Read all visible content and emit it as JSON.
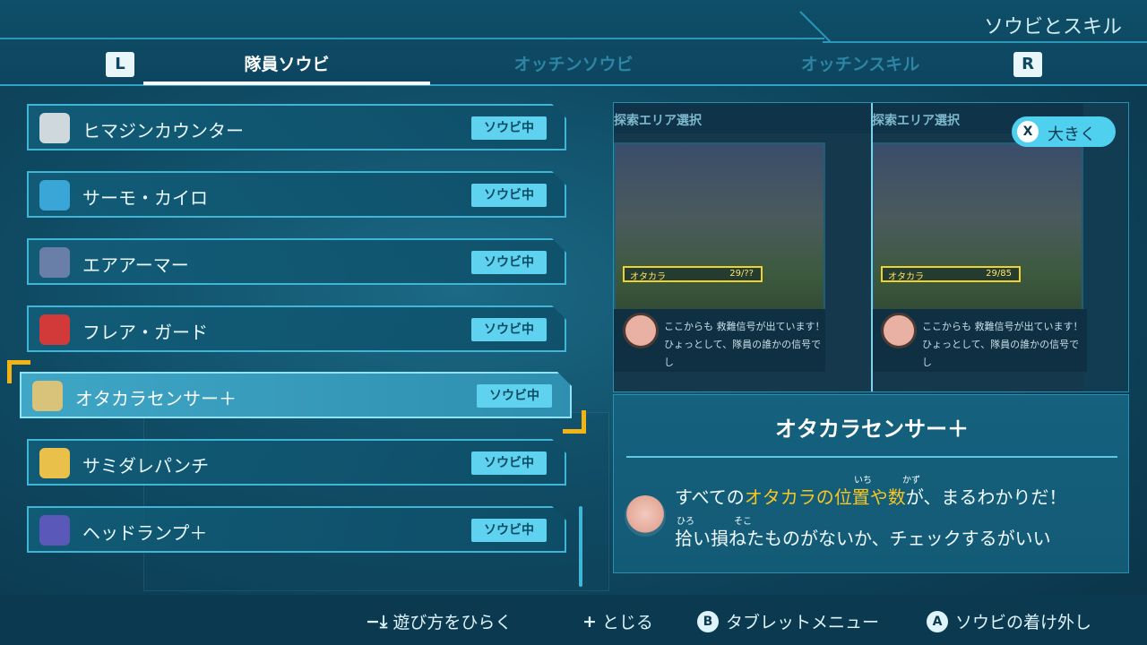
{
  "header": {
    "section_title": "ソウビとスキル",
    "left_bumper": "L",
    "right_bumper": "R",
    "tabs": [
      {
        "label": "隊員ソウビ",
        "active": true
      },
      {
        "label": "オッチンソウビ",
        "active": false
      },
      {
        "label": "オッチンスキル",
        "active": false
      }
    ]
  },
  "list": {
    "items": [
      {
        "name": "ヒマジンカウンター",
        "badge": "ソウビ中",
        "icon": "counter-device-icon"
      },
      {
        "name": "サーモ・カイロ",
        "badge": "ソウビ中",
        "icon": "thermo-warmer-icon"
      },
      {
        "name": "エアアーマー",
        "badge": "ソウビ中",
        "icon": "air-armor-icon"
      },
      {
        "name": "フレア・ガード",
        "badge": "ソウビ中",
        "icon": "flare-guard-icon"
      },
      {
        "name": "オタカラセンサー＋",
        "badge": "ソウビ中",
        "icon": "treasure-sensor-icon",
        "selected": true
      },
      {
        "name": "サミダレパンチ",
        "badge": "ソウビ中",
        "icon": "rapid-punch-icon"
      },
      {
        "name": "ヘッドランプ＋",
        "badge": "ソウビ中",
        "icon": "headlamp-icon"
      }
    ]
  },
  "preview": {
    "screen_title_left": "探索エリア選択",
    "screen_title_right": "探索エリア選択",
    "zoom_button_key": "X",
    "zoom_button_label": "大きく",
    "treasure_label_left": "オタカラ",
    "treasure_count_left": "29/??",
    "treasure_label_right": "オタカラ",
    "treasure_count_right": "29/85",
    "message_line1": "ここからも 救難信号が出ています！",
    "message_line2": "ひょっとして、隊員の誰かの信号でし"
  },
  "description": {
    "title": "オタカラセンサー＋",
    "line1_a": "すべての",
    "line1_hl": "オタカラの",
    "line1_b": "位置や数",
    "line1_c": "が、まるわかりだ！",
    "line2": "拾い損ねたものがないか、チェックするがいい",
    "ruby_ichi": "いち",
    "ruby_kazu": "かず",
    "ruby_hiro": "ひろ",
    "ruby_soko": "そこ"
  },
  "footer": {
    "help_label": "遊び方をひらく",
    "close_label": "とじる",
    "b_key": "B",
    "b_label": "タブレットメニュー",
    "a_key": "A",
    "a_label": "ソウビの着け外し"
  },
  "colors": {
    "accent": "#5ed2ee",
    "highlight": "#f7c623",
    "selection_bracket": "#f2b314"
  }
}
